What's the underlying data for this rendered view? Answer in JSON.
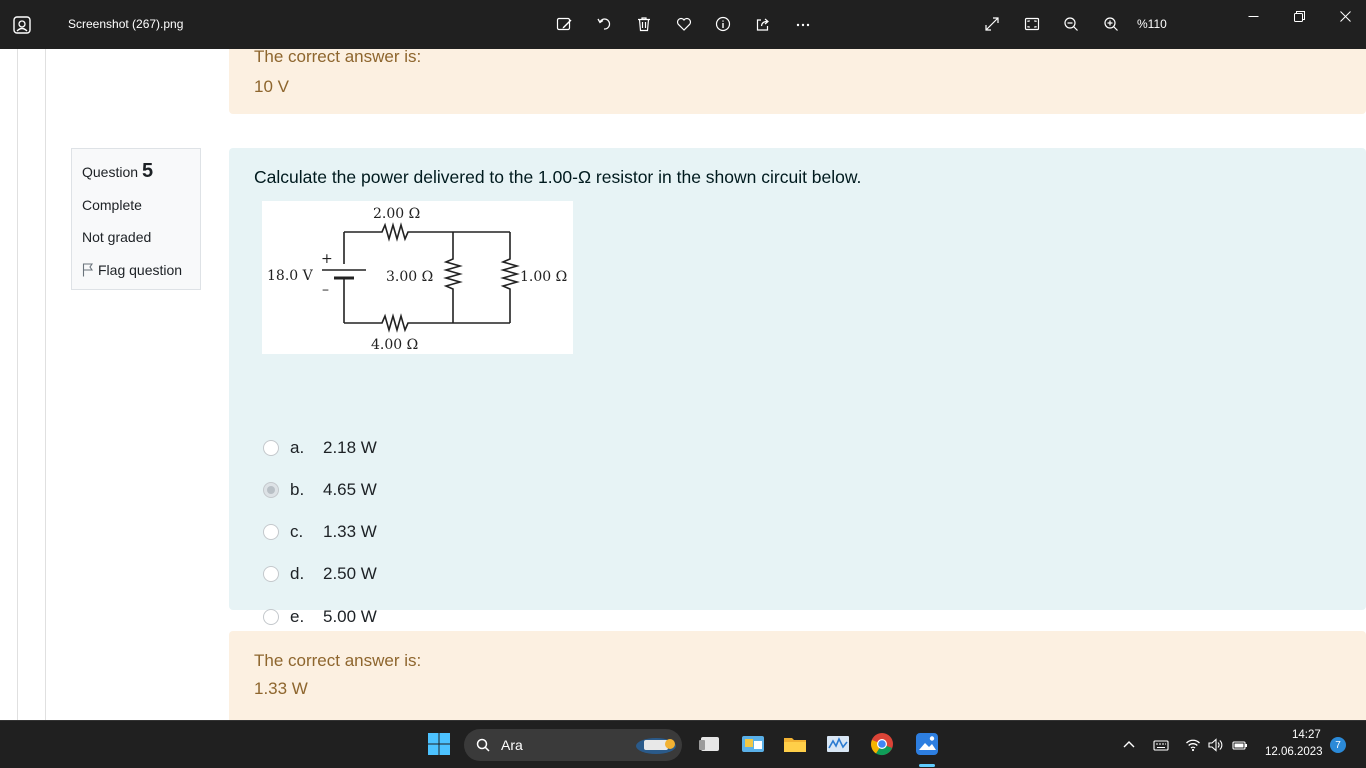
{
  "window": {
    "title": "Screenshot (267).png",
    "zoom": "%110",
    "toolbar_icons": [
      "edit-image-icon",
      "rotate-icon",
      "delete-icon",
      "favorite-icon",
      "info-icon",
      "share-icon",
      "more-icon"
    ],
    "right_icons": [
      "fullscreen-icon",
      "fit-icon",
      "zoom-out-icon",
      "zoom-in-icon"
    ]
  },
  "previous_feedback": {
    "label": "The correct answer is:",
    "answer": "10 V"
  },
  "question_info": {
    "label": "Question",
    "number": "5",
    "state": "Complete",
    "grade": "Not graded",
    "flag": "Flag question"
  },
  "question": {
    "text": "Calculate the power delivered to the 1.00-Ω resistor in the shown circuit below.",
    "circuit": {
      "battery_label": "18.0 V",
      "plus": "+",
      "minus": "–",
      "r_top": "2.00 Ω",
      "r_middle": "3.00 Ω",
      "r_right": "1.00 Ω",
      "r_bottom": "4.00 Ω"
    },
    "options": [
      {
        "letter": "a.",
        "text": "2.18 W",
        "selected": false
      },
      {
        "letter": "b.",
        "text": "4.65 W",
        "selected": true
      },
      {
        "letter": "c.",
        "text": "1.33 W",
        "selected": false
      },
      {
        "letter": "d.",
        "text": "2.50 W",
        "selected": false
      },
      {
        "letter": "e.",
        "text": "5.00 W",
        "selected": false
      }
    ]
  },
  "feedback": {
    "label": "The correct answer is:",
    "answer": "1.33 W"
  },
  "taskbar": {
    "search_label": "Ara",
    "time": "14:27",
    "date": "12.06.2023",
    "notifications": "7"
  }
}
